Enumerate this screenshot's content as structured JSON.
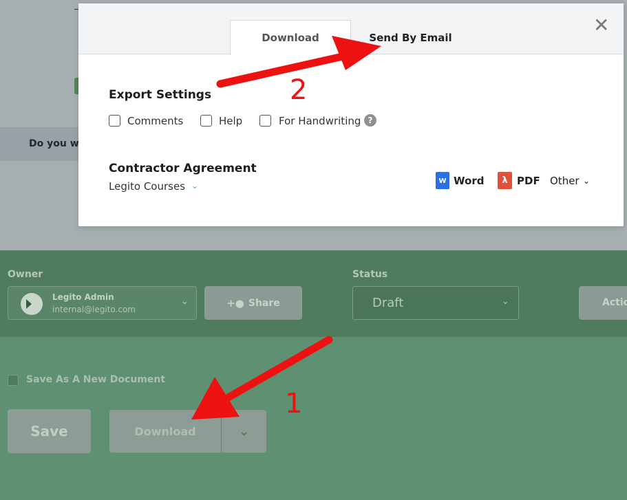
{
  "background": {
    "prompt_text": "Do you wa",
    "owner": {
      "label": "Owner",
      "name": "Legito Admin",
      "email": "internal@legito.com"
    },
    "share_label": "Share",
    "status": {
      "label": "Status",
      "value": "Draft"
    },
    "action_label": "Actio",
    "save_as_new_label": "Save As A New Document",
    "save_label": "Save",
    "download_label": "Download"
  },
  "modal": {
    "tabs": [
      {
        "label": "Download",
        "active": true
      },
      {
        "label": "Send By Email",
        "active": false
      }
    ],
    "close_symbol": "✕",
    "export_settings": {
      "title": "Export Settings",
      "options": [
        {
          "label": "Comments",
          "checked": false
        },
        {
          "label": "Help",
          "checked": false
        },
        {
          "label": "For Handwriting",
          "checked": false
        }
      ],
      "help_symbol": "?"
    },
    "document": {
      "title": "Contractor Agreement",
      "folder": "Legito Courses"
    },
    "formats": {
      "word_label": "Word",
      "word_icon_letter": "W",
      "pdf_label": "PDF",
      "other_label": "Other"
    }
  },
  "annotations": {
    "marker_1": "1",
    "marker_2": "2",
    "arrow_color": "#ee1111"
  }
}
